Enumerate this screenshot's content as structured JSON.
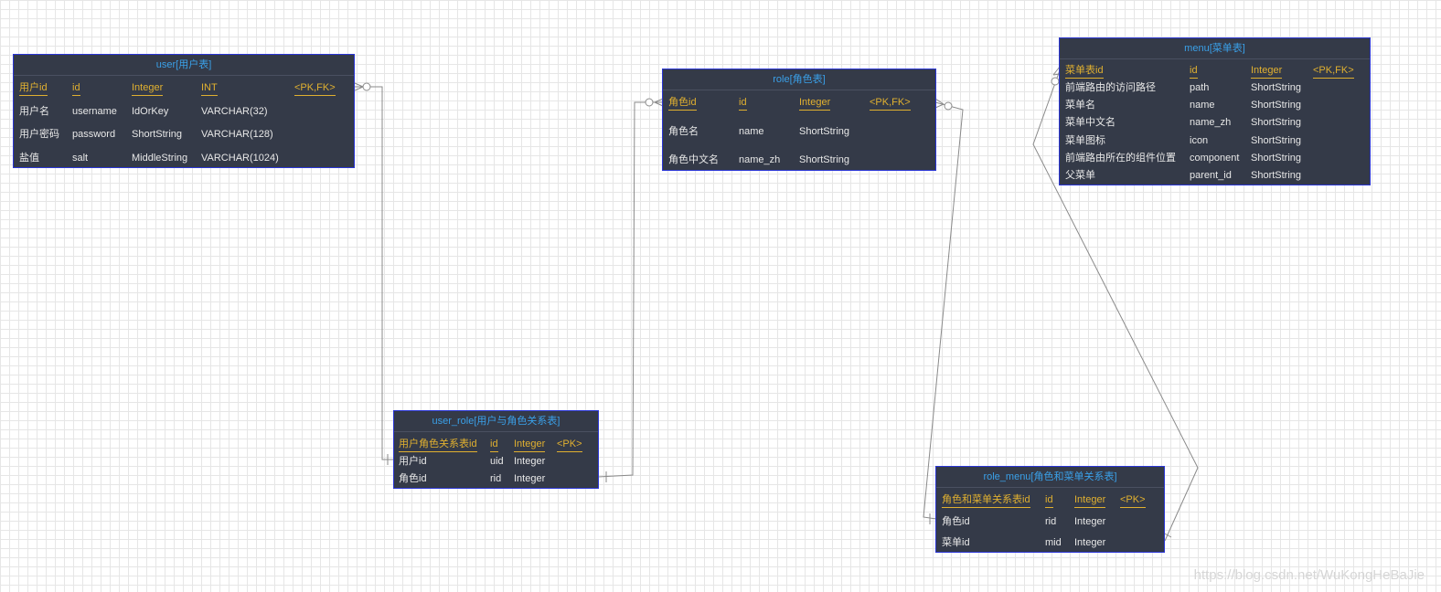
{
  "tables": {
    "user": {
      "title": "user[用户表]",
      "rows": [
        [
          "用户id",
          "id",
          "Integer",
          "INT",
          "<PK,FK>"
        ],
        [
          "用户名",
          "username",
          "IdOrKey",
          "VARCHAR(32)",
          ""
        ],
        [
          "用户密码",
          "password",
          "ShortString",
          "VARCHAR(128)",
          ""
        ],
        [
          "盐值",
          "salt",
          "MiddleString",
          "VARCHAR(1024)",
          ""
        ]
      ]
    },
    "role": {
      "title": "role[角色表]",
      "rows": [
        [
          "角色id",
          "id",
          "Integer",
          "<PK,FK>"
        ],
        [
          "角色名",
          "name",
          "ShortString",
          ""
        ],
        [
          "角色中文名",
          "name_zh",
          "ShortString",
          ""
        ]
      ]
    },
    "menu": {
      "title": "menu[菜单表]",
      "rows": [
        [
          "菜单表id",
          "id",
          "Integer",
          "<PK,FK>"
        ],
        [
          "前端路由的访问路径",
          "path",
          "ShortString",
          ""
        ],
        [
          "菜单名",
          "name",
          "ShortString",
          ""
        ],
        [
          "菜单中文名",
          "name_zh",
          "ShortString",
          ""
        ],
        [
          "菜单图标",
          "icon",
          "ShortString",
          ""
        ],
        [
          "前端路由所在的组件位置",
          "component",
          "ShortString",
          ""
        ],
        [
          "父菜单",
          "parent_id",
          "ShortString",
          ""
        ]
      ]
    },
    "user_role": {
      "title": "user_role[用户与角色关系表]",
      "rows": [
        [
          "用户角色关系表id",
          "id",
          "Integer",
          "<PK>"
        ],
        [
          "用户id",
          "uid",
          "Integer",
          ""
        ],
        [
          "角色id",
          "rid",
          "Integer",
          ""
        ]
      ]
    },
    "role_menu": {
      "title": "role_menu[角色和菜单关系表]",
      "rows": [
        [
          "角色和菜单关系表id",
          "id",
          "Integer",
          "<PK>"
        ],
        [
          "角色id",
          "rid",
          "Integer",
          ""
        ],
        [
          "菜单id",
          "mid",
          "Integer",
          ""
        ]
      ]
    }
  },
  "watermark": "https://blog.csdn.net/WuKongHeBaJie",
  "colors": {
    "background": "#ffffff",
    "grid": "#e6e6e6",
    "entity_fill": "#343a48",
    "entity_border": "#2b36d6",
    "title_text": "#3aa0e8",
    "key_text": "#e0b030",
    "body_text": "#e8e8e8",
    "connector": "#8a8a8a"
  }
}
